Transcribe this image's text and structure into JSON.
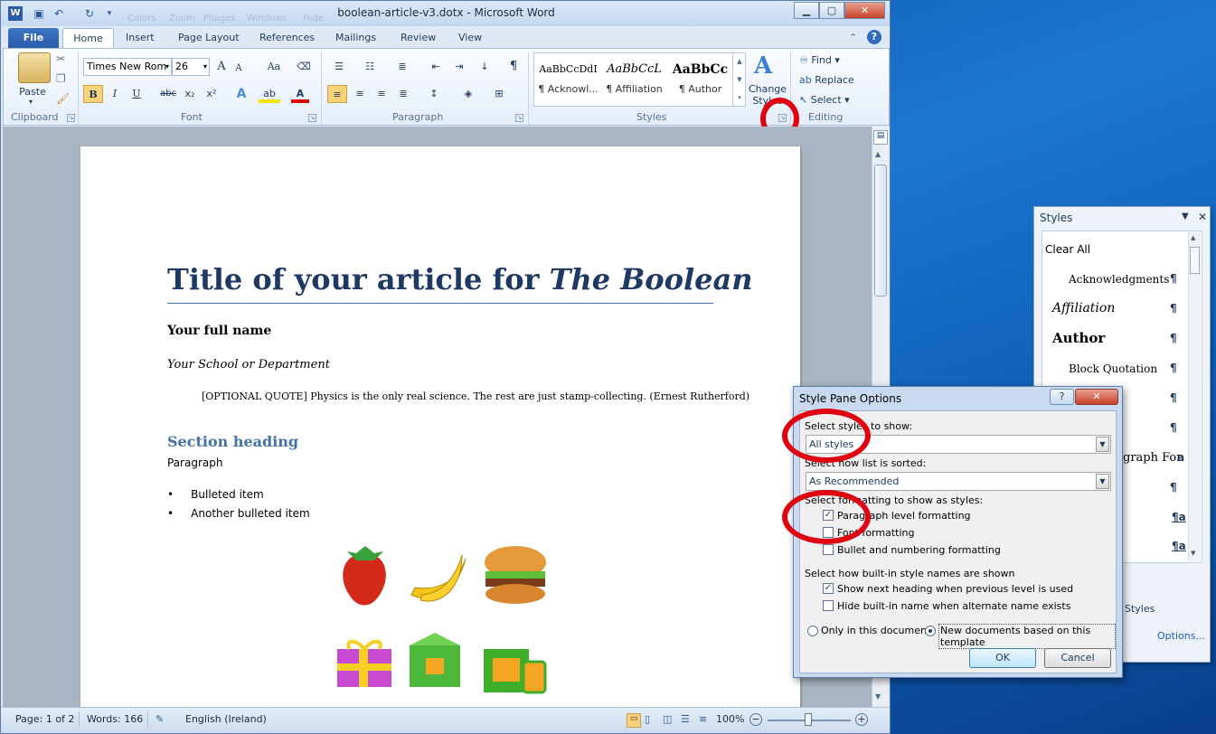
{
  "window": {
    "title": "boolean-article-v3.dotx - Microsoft Word",
    "ghost_qat": [
      "Colors",
      "Zoom",
      "Pilages",
      "Windows",
      "Hide"
    ]
  },
  "tabs": [
    "File",
    "Home",
    "Insert",
    "Page Layout",
    "References",
    "Mailings",
    "Review",
    "View"
  ],
  "ribbon": {
    "clipboard": {
      "label": "Clipboard",
      "paste": "Paste"
    },
    "font": {
      "label": "Font",
      "name": "Times New Rom",
      "size": "26",
      "aa": "Aa",
      "grow": "A",
      "shrink": "A"
    },
    "format_buttons": [
      "B",
      "I",
      "U",
      "abc",
      "x₂",
      "x²"
    ],
    "paragraph": {
      "label": "Paragraph"
    },
    "styles": {
      "label": "Styles",
      "items": [
        {
          "preview": "AaBbCcDdI",
          "name": "¶ Acknowl..."
        },
        {
          "preview": "AaBbCcL",
          "name": "¶ Affiliation"
        },
        {
          "preview": "AaBbCc",
          "name": "¶ Author"
        }
      ],
      "change": "Change Styles"
    },
    "editing": {
      "label": "Editing",
      "find": "Find",
      "replace": "Replace",
      "select": "Select"
    }
  },
  "document": {
    "title_main": "Title of your article for ",
    "title_em": "The Boolean",
    "author": "Your full name",
    "school": "Your School or Department",
    "quote": "[OPTIONAL QUOTE] Physics is the only real science.  The rest are just stamp-collecting.  (Ernest Rutherford)",
    "section": "Section heading",
    "paragraph": "Paragraph",
    "bullets": [
      "Bulleted item",
      "Another bulleted item"
    ],
    "icons": [
      "strawberry",
      "banana",
      "burger",
      "gift",
      "green-box",
      "lunch-box"
    ]
  },
  "status": {
    "page": "Page: 1 of 2",
    "words": "Words: 166",
    "language": "English (Ireland)",
    "zoom": "100%"
  },
  "styles_pane": {
    "title": "Styles",
    "items": [
      "Clear All",
      "Acknowledgments",
      "Affiliation",
      "Author",
      "Block Quotation"
    ],
    "partial": "graph For",
    "partial2": "Styles",
    "options": "Options..."
  },
  "dialog": {
    "title": "Style Pane Options",
    "select_label": "Select styles to show:",
    "select_value": "All styles",
    "sort_label": "Select how list is sorted:",
    "sort_value": "As Recommended",
    "format_label": "Select formatting to show as styles:",
    "checks": [
      {
        "label": "Paragraph level formatting",
        "checked": true
      },
      {
        "label": "Font formatting",
        "checked": false
      },
      {
        "label": "Bullet and numbering formatting",
        "checked": false
      }
    ],
    "builtin_label": "Select how built-in style names are shown",
    "checks2": [
      {
        "label": "Show next heading when previous level is used",
        "checked": true
      },
      {
        "label": "Hide built-in name when alternate name exists",
        "checked": false
      }
    ],
    "radio1": "Only in this document",
    "radio2": "New documents based on this template",
    "ok": "OK",
    "cancel": "Cancel"
  },
  "colors": {
    "accent": "#2a5ba8",
    "title": "#1f3864",
    "section": "#4472a8",
    "highlight": "#e0000f"
  }
}
